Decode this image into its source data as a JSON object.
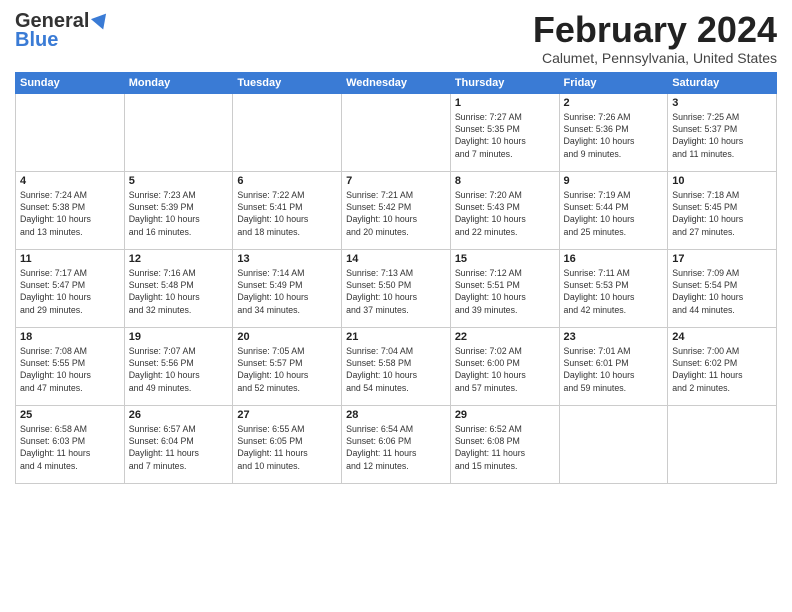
{
  "header": {
    "logo_general": "General",
    "logo_blue": "Blue",
    "title": "February 2024",
    "location": "Calumet, Pennsylvania, United States"
  },
  "days_of_week": [
    "Sunday",
    "Monday",
    "Tuesday",
    "Wednesday",
    "Thursday",
    "Friday",
    "Saturday"
  ],
  "weeks": [
    {
      "days": [
        {
          "num": "",
          "info": ""
        },
        {
          "num": "",
          "info": ""
        },
        {
          "num": "",
          "info": ""
        },
        {
          "num": "",
          "info": ""
        },
        {
          "num": "1",
          "info": "Sunrise: 7:27 AM\nSunset: 5:35 PM\nDaylight: 10 hours\nand 7 minutes."
        },
        {
          "num": "2",
          "info": "Sunrise: 7:26 AM\nSunset: 5:36 PM\nDaylight: 10 hours\nand 9 minutes."
        },
        {
          "num": "3",
          "info": "Sunrise: 7:25 AM\nSunset: 5:37 PM\nDaylight: 10 hours\nand 11 minutes."
        }
      ]
    },
    {
      "days": [
        {
          "num": "4",
          "info": "Sunrise: 7:24 AM\nSunset: 5:38 PM\nDaylight: 10 hours\nand 13 minutes."
        },
        {
          "num": "5",
          "info": "Sunrise: 7:23 AM\nSunset: 5:39 PM\nDaylight: 10 hours\nand 16 minutes."
        },
        {
          "num": "6",
          "info": "Sunrise: 7:22 AM\nSunset: 5:41 PM\nDaylight: 10 hours\nand 18 minutes."
        },
        {
          "num": "7",
          "info": "Sunrise: 7:21 AM\nSunset: 5:42 PM\nDaylight: 10 hours\nand 20 minutes."
        },
        {
          "num": "8",
          "info": "Sunrise: 7:20 AM\nSunset: 5:43 PM\nDaylight: 10 hours\nand 22 minutes."
        },
        {
          "num": "9",
          "info": "Sunrise: 7:19 AM\nSunset: 5:44 PM\nDaylight: 10 hours\nand 25 minutes."
        },
        {
          "num": "10",
          "info": "Sunrise: 7:18 AM\nSunset: 5:45 PM\nDaylight: 10 hours\nand 27 minutes."
        }
      ]
    },
    {
      "days": [
        {
          "num": "11",
          "info": "Sunrise: 7:17 AM\nSunset: 5:47 PM\nDaylight: 10 hours\nand 29 minutes."
        },
        {
          "num": "12",
          "info": "Sunrise: 7:16 AM\nSunset: 5:48 PM\nDaylight: 10 hours\nand 32 minutes."
        },
        {
          "num": "13",
          "info": "Sunrise: 7:14 AM\nSunset: 5:49 PM\nDaylight: 10 hours\nand 34 minutes."
        },
        {
          "num": "14",
          "info": "Sunrise: 7:13 AM\nSunset: 5:50 PM\nDaylight: 10 hours\nand 37 minutes."
        },
        {
          "num": "15",
          "info": "Sunrise: 7:12 AM\nSunset: 5:51 PM\nDaylight: 10 hours\nand 39 minutes."
        },
        {
          "num": "16",
          "info": "Sunrise: 7:11 AM\nSunset: 5:53 PM\nDaylight: 10 hours\nand 42 minutes."
        },
        {
          "num": "17",
          "info": "Sunrise: 7:09 AM\nSunset: 5:54 PM\nDaylight: 10 hours\nand 44 minutes."
        }
      ]
    },
    {
      "days": [
        {
          "num": "18",
          "info": "Sunrise: 7:08 AM\nSunset: 5:55 PM\nDaylight: 10 hours\nand 47 minutes."
        },
        {
          "num": "19",
          "info": "Sunrise: 7:07 AM\nSunset: 5:56 PM\nDaylight: 10 hours\nand 49 minutes."
        },
        {
          "num": "20",
          "info": "Sunrise: 7:05 AM\nSunset: 5:57 PM\nDaylight: 10 hours\nand 52 minutes."
        },
        {
          "num": "21",
          "info": "Sunrise: 7:04 AM\nSunset: 5:58 PM\nDaylight: 10 hours\nand 54 minutes."
        },
        {
          "num": "22",
          "info": "Sunrise: 7:02 AM\nSunset: 6:00 PM\nDaylight: 10 hours\nand 57 minutes."
        },
        {
          "num": "23",
          "info": "Sunrise: 7:01 AM\nSunset: 6:01 PM\nDaylight: 10 hours\nand 59 minutes."
        },
        {
          "num": "24",
          "info": "Sunrise: 7:00 AM\nSunset: 6:02 PM\nDaylight: 11 hours\nand 2 minutes."
        }
      ]
    },
    {
      "days": [
        {
          "num": "25",
          "info": "Sunrise: 6:58 AM\nSunset: 6:03 PM\nDaylight: 11 hours\nand 4 minutes."
        },
        {
          "num": "26",
          "info": "Sunrise: 6:57 AM\nSunset: 6:04 PM\nDaylight: 11 hours\nand 7 minutes."
        },
        {
          "num": "27",
          "info": "Sunrise: 6:55 AM\nSunset: 6:05 PM\nDaylight: 11 hours\nand 10 minutes."
        },
        {
          "num": "28",
          "info": "Sunrise: 6:54 AM\nSunset: 6:06 PM\nDaylight: 11 hours\nand 12 minutes."
        },
        {
          "num": "29",
          "info": "Sunrise: 6:52 AM\nSunset: 6:08 PM\nDaylight: 11 hours\nand 15 minutes."
        },
        {
          "num": "",
          "info": ""
        },
        {
          "num": "",
          "info": ""
        }
      ]
    }
  ]
}
